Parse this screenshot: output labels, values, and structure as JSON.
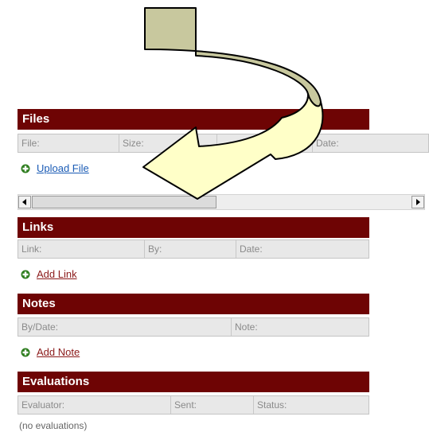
{
  "colors": {
    "header": "#6e0404",
    "arrow_fill": "#c8c89e",
    "arrow_tip": "#ffffc8",
    "link_blue": "#1a5bb5",
    "link_red": "#8b1a1a"
  },
  "files": {
    "title": "Files",
    "columns": [
      "File:",
      "Size:",
      "",
      "Date:"
    ],
    "action_label": "Upload File"
  },
  "links": {
    "title": "Links",
    "columns": [
      "Link:",
      "By:",
      "Date:"
    ],
    "action_label": "Add Link"
  },
  "notes": {
    "title": "Notes",
    "columns": [
      "By/Date:",
      "Note:"
    ],
    "action_label": "Add Note"
  },
  "evaluations": {
    "title": "Evaluations",
    "columns": [
      "Evaluator:",
      "Sent:",
      "Status:"
    ],
    "empty_text": "(no evaluations)"
  }
}
